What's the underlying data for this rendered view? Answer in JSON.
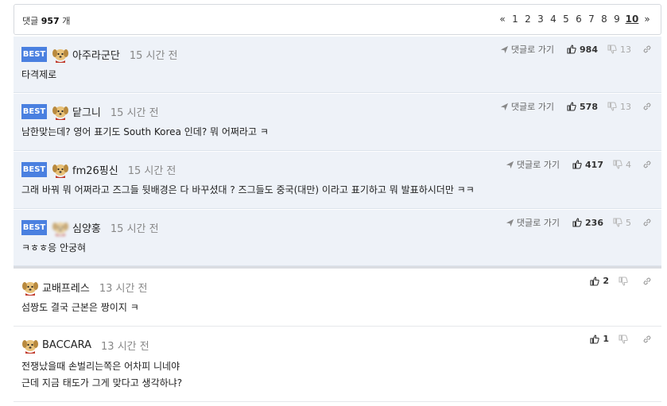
{
  "header": {
    "count_prefix": "댓글",
    "count_value": "957",
    "count_suffix": "개",
    "pager": {
      "prev": "«",
      "pages": [
        "1",
        "2",
        "3",
        "4",
        "5",
        "6",
        "7",
        "8",
        "9"
      ],
      "current": "10",
      "next": "»"
    }
  },
  "comments": [
    {
      "best": true,
      "badge": "BEST",
      "author": "아주라군단",
      "time": "15 시간 전",
      "goto": "댓글로 가기",
      "likes": "984",
      "dislikes": "13",
      "text": "타격제로"
    },
    {
      "best": true,
      "badge": "BEST",
      "author": "닽그니",
      "time": "15 시간 전",
      "goto": "댓글로 가기",
      "likes": "578",
      "dislikes": "13",
      "text": "남한맞는데? 영어 표기도 South Korea 인데? 뭐 어쩌라고 ㅋ"
    },
    {
      "best": true,
      "badge": "BEST",
      "author": "fm26핑신",
      "time": "15 시간 전",
      "goto": "댓글로 가기",
      "likes": "417",
      "dislikes": "4",
      "text": "그래 바꿔 뭐 어쩌라고 즈그들 뒷배경은 다 바꾸셨대 ? 즈그들도 중국(대만) 이라고 표기하고 뭐 발표하시더만 ㅋㅋ"
    },
    {
      "best": true,
      "badge": "BEST",
      "author": "심양홍",
      "time": "15 시간 전",
      "goto": "댓글로 가기",
      "likes": "236",
      "dislikes": "5",
      "text": "ㅋㅎㅎ응 안궁혀"
    },
    {
      "best": false,
      "author": "교배프레스",
      "time": "13 시간 전",
      "likes": "2",
      "text": "섬짱도 결국 근본은 짱이지 ㅋ"
    },
    {
      "best": false,
      "author": "BACCARA",
      "time": "13 시간 전",
      "likes": "1",
      "text_line1": "전쟁났을때 손벌리는쪽은 어차피 니네야",
      "text_line2": "근데 지금 태도가 그게 맞다고 생각하냐?"
    }
  ],
  "icons": {
    "avatar": "dog-avatar-icon",
    "goto": "send-arrow-icon",
    "like": "thumbs-up-icon",
    "dislike": "thumbs-down-icon",
    "link": "link-icon"
  },
  "colors": {
    "best_badge": "#4a80e0",
    "best_bg": "#eef2f8"
  }
}
